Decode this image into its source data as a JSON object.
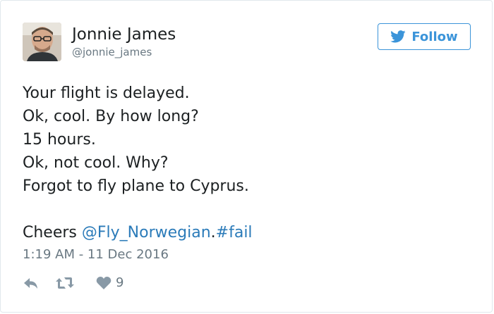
{
  "user": {
    "name": "Jonnie James",
    "handle": "@jonnie_james"
  },
  "follow_button": {
    "label": "Follow",
    "icon": "twitter-bird-icon",
    "color": "#3b94d9"
  },
  "tweet": {
    "lines": [
      "Your flight is delayed.",
      "Ok, cool. By how long?",
      "15 hours.",
      "Ok, not cool. Why?",
      "Forgot to fly plane to Cyprus."
    ],
    "closing_text": "Cheers ",
    "mention": "@Fly_Norwegian",
    "separator": ".",
    "hashtag": "#fail",
    "link_color": "#2b7bb9"
  },
  "timestamp": "1:19 AM - 11 Dec 2016",
  "actions": {
    "reply_icon": "reply-icon",
    "retweet_icon": "retweet-icon",
    "like_icon": "heart-icon",
    "like_count": "9"
  }
}
